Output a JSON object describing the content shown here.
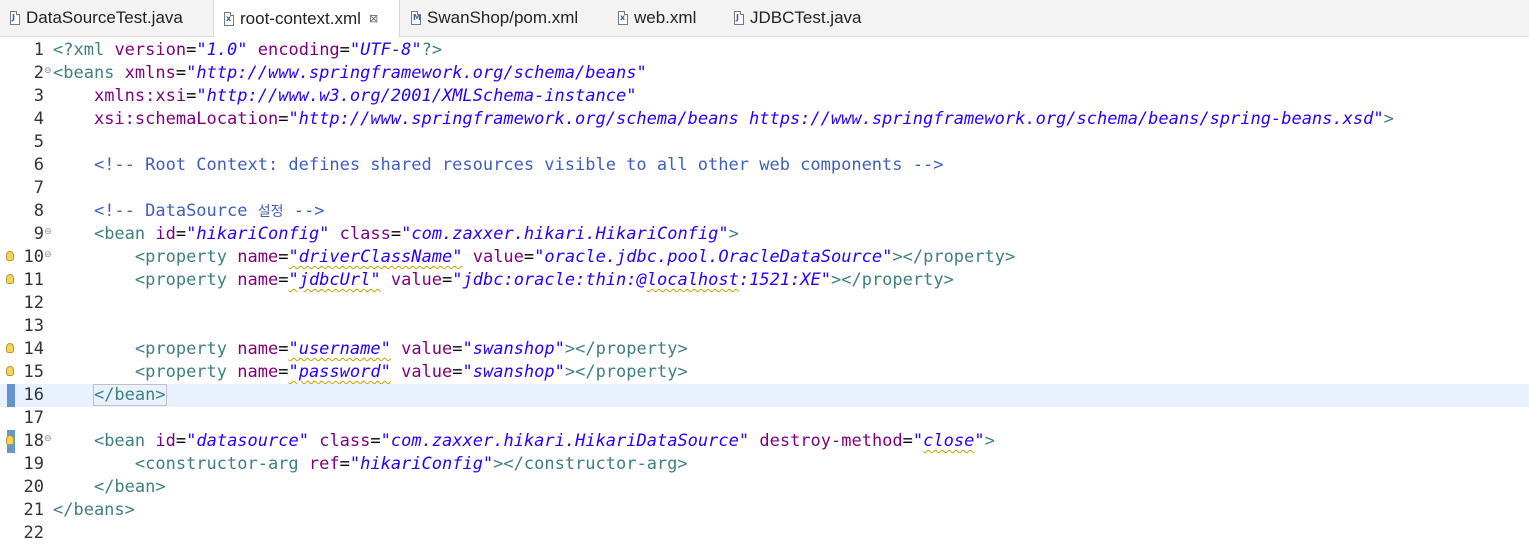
{
  "tabs": [
    {
      "label": "DataSourceTest.java",
      "icon": "java-file-icon",
      "glyph": "J",
      "active": false
    },
    {
      "label": "root-context.xml",
      "icon": "xml-file-icon",
      "glyph": "x",
      "active": true,
      "close": "⊠"
    },
    {
      "label": "SwanShop/pom.xml",
      "icon": "maven-pom-icon",
      "glyph": "M",
      "active": false
    },
    {
      "label": "web.xml",
      "icon": "xml-file-icon",
      "glyph": "x",
      "active": false
    },
    {
      "label": "JDBCTest.java",
      "icon": "java-file-icon",
      "glyph": "J",
      "active": false
    }
  ],
  "editor": {
    "lines": [
      {
        "n": "1"
      },
      {
        "n": "2",
        "fold": "⊖"
      },
      {
        "n": "3"
      },
      {
        "n": "4"
      },
      {
        "n": "5"
      },
      {
        "n": "6"
      },
      {
        "n": "7"
      },
      {
        "n": "8"
      },
      {
        "n": "9",
        "fold": "⊖"
      },
      {
        "n": "10",
        "fold": "⊖"
      },
      {
        "n": "11"
      },
      {
        "n": "12"
      },
      {
        "n": "13"
      },
      {
        "n": "14"
      },
      {
        "n": "15"
      },
      {
        "n": "16"
      },
      {
        "n": "17"
      },
      {
        "n": "18",
        "fold": "⊖"
      },
      {
        "n": "19"
      },
      {
        "n": "20"
      },
      {
        "n": "21"
      },
      {
        "n": "22"
      }
    ],
    "code": {
      "l1": {
        "open": "<?xml",
        "a1": "version",
        "v1": "\"1.0\"",
        "a2": "encoding",
        "v2": "\"UTF-8\"",
        "close": "?>"
      },
      "l2": {
        "open": "<beans",
        "a1": "xmlns",
        "v1": "\"http://www.springframework.org/schema/beans\""
      },
      "l3": {
        "a1": "xmlns:xsi",
        "v1": "\"http://www.w3.org/2001/XMLSchema-instance\""
      },
      "l4": {
        "a1": "xsi:schemaLocation",
        "v1": "\"http://www.springframework.org/schema/beans https://www.springframework.org/schema/beans/spring-beans.xsd\"",
        "close": ">"
      },
      "l6": {
        "comment": "<!-- Root Context: defines shared resources visible to all other web components -->"
      },
      "l8": {
        "comment_a": "<!-- DataSource ",
        "comment_b": "설정",
        "comment_c": " -->"
      },
      "l9": {
        "open": "<bean",
        "a1": "id",
        "v1": "\"hikariConfig\"",
        "a2": "class",
        "v2": "\"com.zaxxer.hikari.HikariConfig\"",
        "close": ">"
      },
      "l10": {
        "open": "<property",
        "a1": "name",
        "v1": "\"driverClassName\"",
        "a2": "value",
        "v2": "\"oracle.jdbc.pool.OracleDataSource\"",
        "close": "></property>"
      },
      "l11": {
        "open": "<property",
        "a1": "name",
        "v1": "\"jdbcUrl\"",
        "a2": "value",
        "v2a": "\"jdbc:oracle:thin:@",
        "v2b": "localhost",
        "v2c": ":1521:XE\"",
        "close": "></property>"
      },
      "l14": {
        "open": "<property",
        "a1": "name",
        "v1": "\"username\"",
        "a2": "value",
        "v2": "\"swanshop\"",
        "close": "></property>"
      },
      "l15": {
        "open": "<property",
        "a1": "name",
        "v1": "\"password\"",
        "a2": "value",
        "v2": "\"swanshop\"",
        "close": "></property>"
      },
      "l16": {
        "tag": "</bean>"
      },
      "l18": {
        "open": "<bean",
        "a1": "id",
        "v1": "\"datasource\"",
        "a2": "class",
        "v2": "\"com.zaxxer.hikari.HikariDataSource\"",
        "a3": "destroy-method",
        "v3a": "\"",
        "v3b": "close",
        "v3c": "\"",
        "close": ">"
      },
      "l19": {
        "open": "<constructor-arg",
        "a1": "ref",
        "v1": "\"hikariConfig\"",
        "close": "></constructor-arg>"
      },
      "l20": {
        "tag": "</bean>"
      },
      "l21": {
        "tag": "</beans>"
      }
    },
    "indent1": "    ",
    "indent2": "        "
  }
}
